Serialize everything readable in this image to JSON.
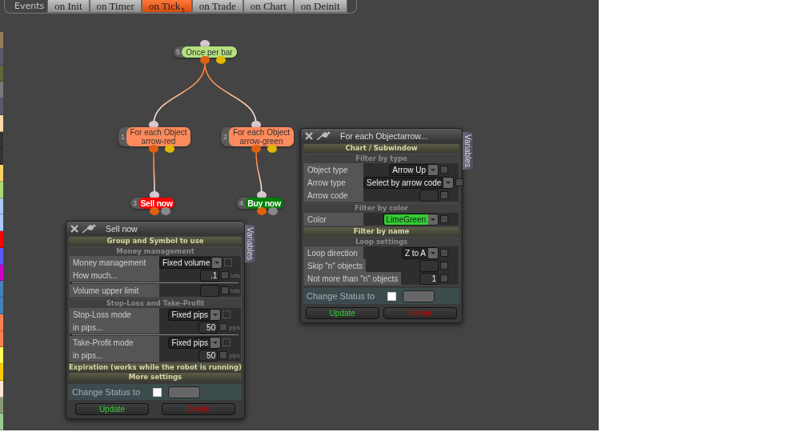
{
  "tabs_label": "Events",
  "tabs": [
    {
      "label": "on Init",
      "selected": false
    },
    {
      "label": "on Timer",
      "selected": false
    },
    {
      "label": "on Tick",
      "selected": true,
      "badge": "5"
    },
    {
      "label": "on Trade",
      "selected": false
    },
    {
      "label": "on Chart",
      "selected": false
    },
    {
      "label": "on Deinit",
      "selected": false
    }
  ],
  "color_strip": [
    {
      "color": "#9a7c5c"
    },
    {
      "color": "#5a5a6e"
    },
    {
      "color": "#5e6a3c"
    },
    {
      "color": "#7a7a7a"
    },
    {
      "color": "#5a5a6e"
    },
    {
      "color": "#ffd9a8"
    },
    {
      "color": "#333333"
    },
    {
      "color": "#333333"
    },
    {
      "color": "#ffd066"
    },
    {
      "color": "#a8dc78"
    },
    {
      "color": "#aac8ff"
    },
    {
      "color": "#aac8ff"
    },
    {
      "color": "#ff0000"
    },
    {
      "color": "#5a5aff"
    },
    {
      "color": "#cc00cc"
    },
    {
      "color": "#4682b4"
    },
    {
      "color": "#4682b4"
    },
    {
      "color": "#ff7f50"
    },
    {
      "color": "#ff7f50"
    },
    {
      "color": "#ffff55"
    },
    {
      "color": "#ffcc00"
    },
    {
      "color": "#ffe4d4"
    },
    {
      "color": "#8a9a78"
    },
    {
      "color": "#98cc90"
    }
  ],
  "graph": {
    "number": "5",
    "label": "Once per bar",
    "kind": "condition",
    "color": "#b4e080",
    "children": [
      {
        "number": "1",
        "label": "For each Object arrow-red",
        "kind": "loop",
        "color": "#ff8a5c",
        "children": [
          {
            "number": "3",
            "label": "Sell now",
            "kind": "action",
            "color": "#ff0000"
          }
        ]
      },
      {
        "number": "2",
        "label": "For each Object arrow-green",
        "kind": "loop",
        "color": "#ff8a5c",
        "children": [
          {
            "number": "4",
            "label": "Buy now",
            "kind": "action",
            "color": "#008000"
          }
        ]
      }
    ]
  },
  "dialogs": [
    {
      "title": "Sell now",
      "side_tab": "Variables",
      "sections": [
        {
          "kind": "header",
          "label": "Group and Symbol to use"
        },
        {
          "kind": "subheader",
          "label": "Money management"
        },
        {
          "kind": "group",
          "blocks": [
            [
              {
                "label": "Money management",
                "kind": "select",
                "value": "Fixed volume",
                "checkbox": {
                  "checked": false,
                  "disabled": true
                }
              },
              {
                "label": "How much...",
                "kind": "input",
                "value": ".1",
                "unit": "lots",
                "checkbox": {
                  "checked": false,
                  "disabled": false
                }
              }
            ],
            [
              {
                "label": "Volume upper limit",
                "kind": "input",
                "unit": "lots",
                "checkbox": {
                  "checked": false,
                  "disabled": false
                }
              }
            ]
          ]
        },
        {
          "kind": "subheader",
          "label": "Stop-Loss and Take-Profit"
        },
        {
          "kind": "group",
          "blocks": [
            [
              {
                "label": "Stop-Loss mode",
                "kind": "select",
                "value": "Fixed pips",
                "checkbox": {
                  "checked": false,
                  "disabled": true
                }
              },
              {
                "label": "in pips...",
                "kind": "input",
                "value": "50",
                "unit": "pips",
                "checkbox": {
                  "checked": false,
                  "disabled": false
                }
              }
            ],
            [
              {
                "label": "Take-Profit mode",
                "kind": "select",
                "value": "Fixed pips",
                "checkbox": {
                  "checked": false,
                  "disabled": true
                }
              },
              {
                "label": "in pips...",
                "kind": "input",
                "value": "50",
                "unit": "pips",
                "checkbox": {
                  "checked": false,
                  "disabled": false
                }
              }
            ]
          ]
        },
        {
          "kind": "header",
          "label": "Expiration (works while the robot is running)"
        },
        {
          "kind": "header",
          "label": "More settings"
        }
      ],
      "status": {
        "label": "Change Status to",
        "checked": false
      },
      "buttons": [
        {
          "label": "Update",
          "kind": "update"
        },
        {
          "label": "Delete",
          "kind": "delete"
        }
      ]
    },
    {
      "title": "For each Objectarrow...",
      "side_tab": "Variables",
      "sections": [
        {
          "kind": "header",
          "label": "Chart / Subwindow"
        },
        {
          "kind": "subheader",
          "label": "Filter by type"
        },
        {
          "kind": "group",
          "blocks": [
            [
              {
                "label": "Object type",
                "kind": "select",
                "value": "Arrow Up",
                "checkbox": {
                  "checked": false,
                  "disabled": false
                }
              },
              {
                "label": "Arrow type",
                "kind": "select",
                "value": "Select by arrow code",
                "checkbox": {
                  "checked": false,
                  "disabled": false
                }
              },
              {
                "label": "Arrow code",
                "kind": "input",
                "checkbox": {
                  "checked": false,
                  "disabled": false
                }
              }
            ]
          ]
        },
        {
          "kind": "subheader",
          "label": "Filter by color"
        },
        {
          "kind": "group",
          "blocks": [
            [
              {
                "label": "Color",
                "kind": "select",
                "value": "LimeGreen",
                "color": "#32cd32",
                "checkbox": {
                  "checked": false,
                  "disabled": false
                }
              }
            ]
          ]
        },
        {
          "kind": "header",
          "label": "Filter by name"
        },
        {
          "kind": "subheader",
          "label": "Loop settings"
        },
        {
          "kind": "group",
          "blocks": [
            [
              {
                "label": "Loop direction",
                "kind": "select",
                "value": "Z to A",
                "checkbox": {
                  "checked": false,
                  "disabled": false
                }
              },
              {
                "label": "Skip \"n\" objects",
                "kind": "input",
                "checkbox": {
                  "checked": false,
                  "disabled": false
                }
              },
              {
                "label": "Not more than \"n\" objects",
                "kind": "input",
                "value": "1",
                "checkbox": {
                  "checked": false,
                  "disabled": false
                }
              }
            ]
          ]
        }
      ],
      "status": {
        "label": "Change Status to",
        "checked": false
      },
      "buttons": [
        {
          "label": "Update",
          "kind": "update"
        },
        {
          "label": "Delete",
          "kind": "delete"
        }
      ]
    }
  ]
}
